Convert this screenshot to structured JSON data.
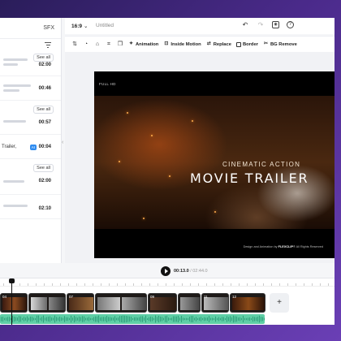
{
  "left_panel": {
    "tabs": [
      "",
      "SFX"
    ],
    "see_all_label": "See all",
    "durations": [
      "02:00",
      "00:46",
      "00:57",
      "00:04",
      "02:00",
      "02:10"
    ],
    "snippet": "Trailer,",
    "badge": "AI"
  },
  "topbar": {
    "ratio": "16:9",
    "ratio_chevron": "⌄",
    "title": "Untitled"
  },
  "toolbar": {
    "animation": "Animation",
    "inside_motion": "Inside Motion",
    "replace": "Replace",
    "border": "Border",
    "bg_remove": "BG Remove"
  },
  "video": {
    "badge": "FULL HD",
    "subheadline": "CINEMATIC ACTION",
    "headline": "MOVIE TRAILER",
    "credit_prefix": "Design and Animation by",
    "credit_brand": "FLEXCLIP",
    "credit_suffix": "® All Rights Reserved"
  },
  "player": {
    "current_time": "00:13.0",
    "total_time": "/ 02:44.0"
  },
  "timeline": {
    "clip_numbers": [
      "04",
      "",
      "07",
      "",
      "09",
      "",
      "11",
      "12"
    ],
    "add_label": "+"
  },
  "colors": {
    "accent": "#2f8cf0",
    "audio": "#5fcfa6",
    "background_gradient_start": "#2a1d5a",
    "background_gradient_end": "#6a3fb5"
  }
}
